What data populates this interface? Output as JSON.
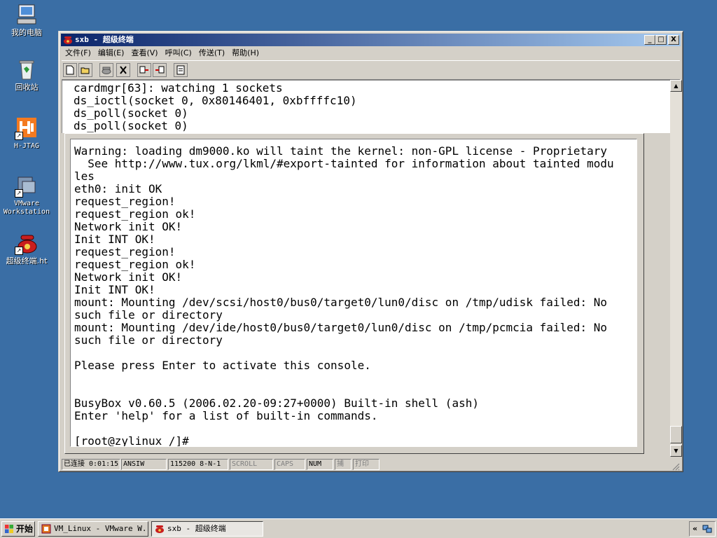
{
  "desktop": {
    "icons": [
      {
        "label": "我的电脑"
      },
      {
        "label": "回收站"
      },
      {
        "label": "H-JTAG"
      },
      {
        "label_line1": "VMware",
        "label_line2": "Workstation"
      },
      {
        "label": "超级终端.ht"
      }
    ]
  },
  "window": {
    "title": "sxb - 超级终端",
    "buttons": {
      "minimize": "_",
      "maximize": "□",
      "close": "X"
    },
    "menu": [
      "文件(F)",
      "编辑(E)",
      "查看(V)",
      "呼叫(C)",
      "传送(T)",
      "帮助(H)"
    ]
  },
  "terminal": {
    "scrollback": [
      "cardmgr[63]: watching 1 sockets",
      "ds_ioctl(socket 0, 0x80146401, 0xbffffc10)",
      "ds_poll(socket 0)",
      "ds_poll(socket 0)"
    ],
    "console": [
      "Warning: loading dm9000.ko will taint the kernel: non-GPL license - Proprietary",
      "  See http://www.tux.org/lkml/#export-tainted for information about tainted modu",
      "les",
      "eth0: init OK",
      "request_region!",
      "request_region ok!",
      "Network init OK!",
      "Init INT OK!",
      "request_region!",
      "request_region ok!",
      "Network init OK!",
      "Init INT OK!",
      "mount: Mounting /dev/scsi/host0/bus0/target0/lun0/disc on /tmp/udisk failed: No",
      "such file or directory",
      "mount: Mounting /dev/ide/host0/bus0/target0/lun0/disc on /tmp/pcmcia failed: No",
      "such file or directory",
      "",
      "Please press Enter to activate this console.",
      "",
      "",
      "BusyBox v0.60.5 (2006.02.20-09:27+0000) Built-in shell (ash)",
      "Enter 'help' for a list of built-in commands.",
      "",
      "[root@zylinux /]#"
    ]
  },
  "status": {
    "connected": "已连接 0:01:15",
    "emulation": "ANSIW",
    "port": "115200 8-N-1",
    "scroll": "SCROLL",
    "caps": "CAPS",
    "num": "NUM",
    "capture": "捕",
    "print": "打印"
  },
  "taskbar": {
    "start": "开始",
    "tasks": [
      {
        "label": "VM_Linux - VMware W..."
      },
      {
        "label": "sxb - 超级终端"
      }
    ],
    "tray_arrow": "«"
  },
  "colors": {
    "desktop": "#3a6ea5",
    "titlebar_start": "#0a246a",
    "titlebar_end": "#a6caf0",
    "face": "#d4d0c8"
  }
}
